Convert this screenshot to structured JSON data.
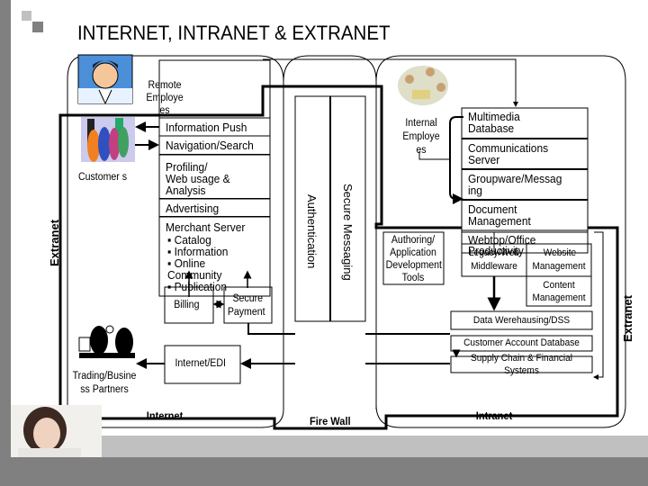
{
  "slide": {
    "title": "INTERNET, INTRANET & EXTRANET"
  },
  "zones": {
    "internet": "Internet",
    "firewall": "Fire Wall",
    "intranet": "Intranet",
    "extranet_left": "Extranet",
    "extranet_right": "Extranet"
  },
  "actors": {
    "remote_employees": "Remote Employe es",
    "customers": "Customer s",
    "trading_partners": "Trading/Busine ss Partners",
    "internal_employees": "Internal Employe es"
  },
  "internet_services": {
    "information_push": "Information Push",
    "navigation_search": "Navigation/Search",
    "profiling": [
      "Profiling/",
      "Web usage &",
      "Analysis"
    ],
    "advertising": "Advertising",
    "merchant_server": {
      "title": "Merchant Server",
      "bullets": [
        "Catalog",
        "Information",
        "Online Community",
        "Publication"
      ]
    },
    "billing": "Billing",
    "secure_payment": [
      "Secure",
      "Payment"
    ],
    "internet_edi": "Internet/EDI"
  },
  "firewall_layers": {
    "authentication": "Authentication",
    "secure_messaging": "Secure Messaging"
  },
  "intranet_services": {
    "multimedia_database": [
      "Multimedia",
      "Database"
    ],
    "communications_server": [
      "Communications",
      "Server"
    ],
    "groupware": [
      "Groupware/Messag",
      "ing"
    ],
    "document_management": [
      "Document",
      "Management"
    ],
    "webtop_office": [
      "Webtop/Office",
      "Productivity"
    ],
    "authoring_tools": [
      "Authoring/",
      "Application",
      "Development",
      "Tools"
    ],
    "legacy_middleware": [
      "Legacy/Web",
      "Middleware"
    ],
    "website_management": [
      "Website",
      "Management"
    ],
    "content_management": [
      "Content",
      "Management"
    ],
    "data_warehousing": "Data Werehausing/DSS",
    "customer_account_db": "Customer Account Database",
    "supply_chain": [
      "Supply Chain & Financial",
      "Systems"
    ]
  }
}
